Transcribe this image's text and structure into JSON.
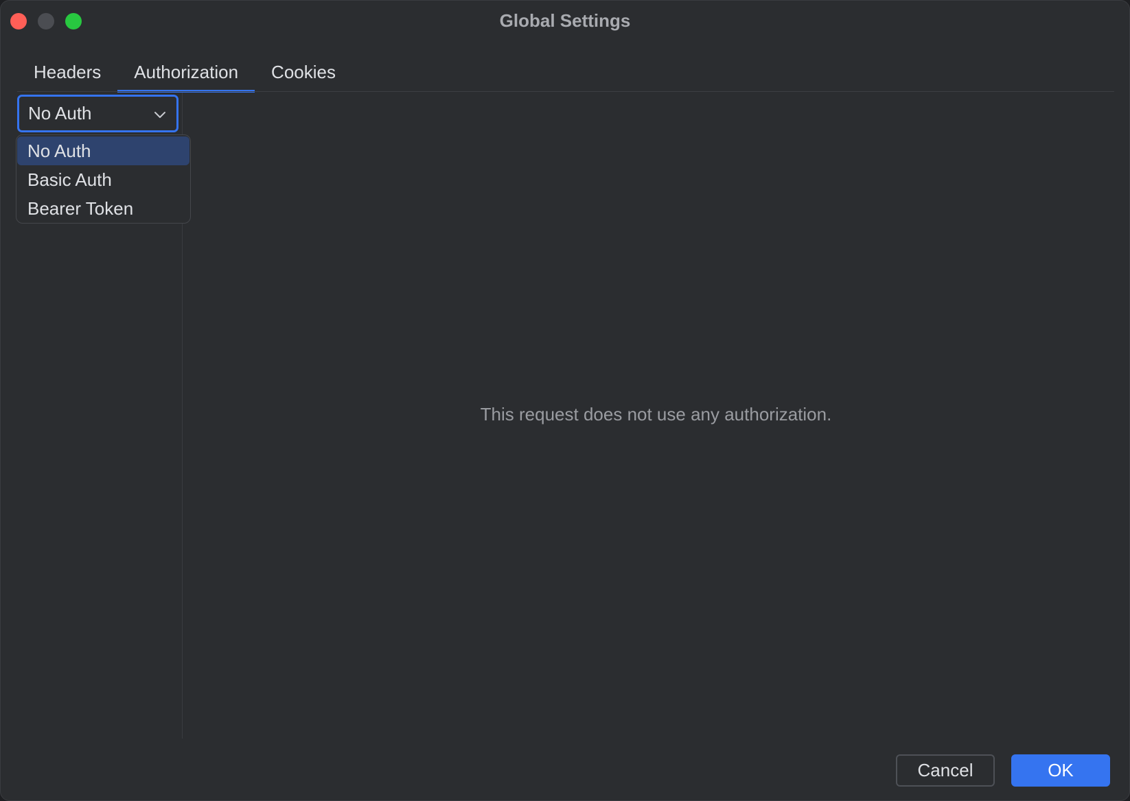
{
  "window": {
    "title": "Global Settings"
  },
  "tabs": [
    {
      "label": "Headers",
      "active": false
    },
    {
      "label": "Authorization",
      "active": true
    },
    {
      "label": "Cookies",
      "active": false
    }
  ],
  "auth": {
    "selected": "No Auth",
    "options": [
      "No Auth",
      "Basic Auth",
      "Bearer Token"
    ],
    "empty_message": "This request does not use any authorization."
  },
  "footer": {
    "cancel_label": "Cancel",
    "ok_label": "OK"
  },
  "colors": {
    "accent": "#3574f0",
    "background": "#2b2d30",
    "selected_option": "#2e436e"
  }
}
